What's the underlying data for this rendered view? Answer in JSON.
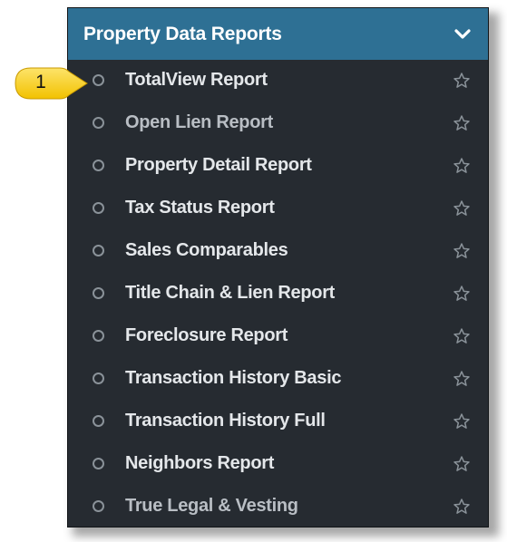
{
  "panel": {
    "title": "Property Data Reports",
    "collapse_icon": "chevron-down-icon"
  },
  "callout": {
    "number": "1",
    "color": "#f7d11b"
  },
  "items": [
    {
      "label": "TotalView Report",
      "icon": "radio-circle-icon",
      "fav_icon": "star-outline-icon"
    },
    {
      "label": "Open Lien Report",
      "icon": "radio-circle-icon",
      "fav_icon": "star-outline-icon"
    },
    {
      "label": "Property Detail Report",
      "icon": "radio-circle-icon",
      "fav_icon": "star-outline-icon"
    },
    {
      "label": "Tax Status Report",
      "icon": "radio-circle-icon",
      "fav_icon": "star-outline-icon"
    },
    {
      "label": "Sales Comparables",
      "icon": "radio-circle-icon",
      "fav_icon": "star-outline-icon"
    },
    {
      "label": "Title Chain & Lien Report",
      "icon": "radio-circle-icon",
      "fav_icon": "star-outline-icon"
    },
    {
      "label": "Foreclosure Report",
      "icon": "radio-circle-icon",
      "fav_icon": "star-outline-icon"
    },
    {
      "label": "Transaction History Basic",
      "icon": "radio-circle-icon",
      "fav_icon": "star-outline-icon"
    },
    {
      "label": "Transaction History Full",
      "icon": "radio-circle-icon",
      "fav_icon": "star-outline-icon"
    },
    {
      "label": "Neighbors Report",
      "icon": "radio-circle-icon",
      "fav_icon": "star-outline-icon"
    },
    {
      "label": "True Legal & Vesting",
      "icon": "radio-circle-icon",
      "fav_icon": "star-outline-icon"
    }
  ],
  "colors": {
    "header_bg": "#2e7094",
    "panel_bg": "#262b31",
    "text": "#e4e7ea",
    "icon": "#8a9299"
  }
}
